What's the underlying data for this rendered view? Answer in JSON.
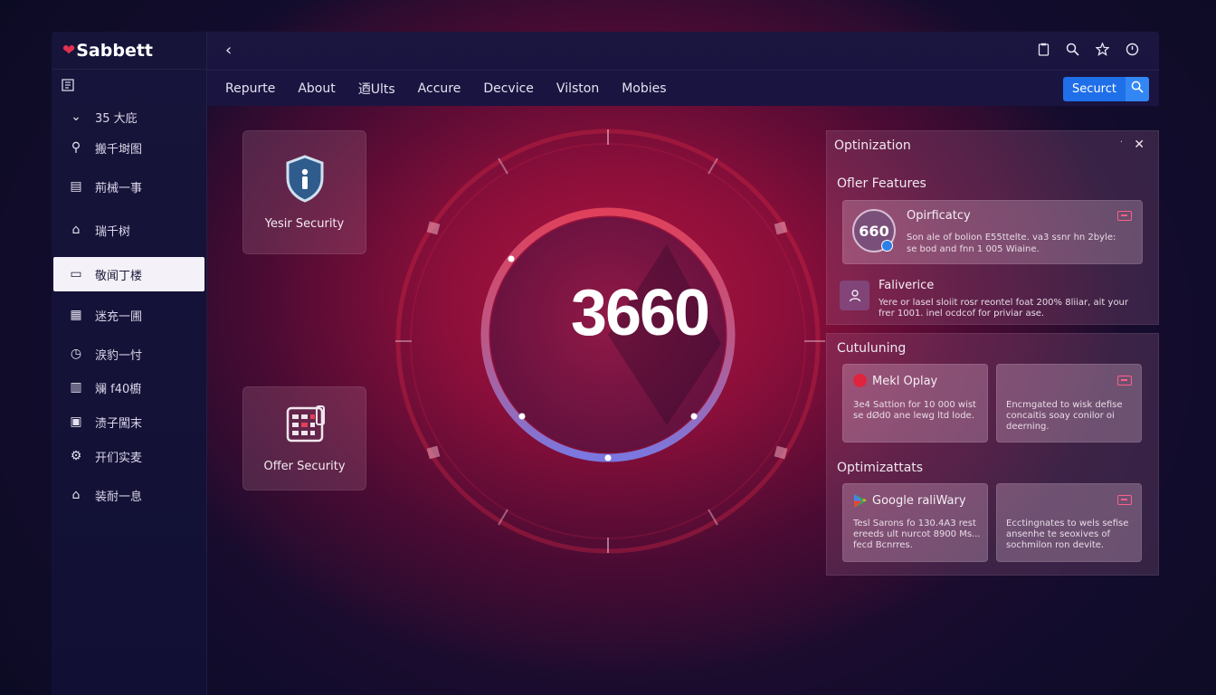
{
  "app": {
    "brand": "Sabbett"
  },
  "sidebar": {
    "items": [
      {
        "label": "35 大庇",
        "icon": "chevron-down-icon"
      },
      {
        "label": "搬千埘图",
        "icon": "search-icon"
      },
      {
        "label": "荊械一事",
        "icon": "list-icon"
      },
      {
        "label": "瑞千树",
        "icon": "home-icon"
      },
      {
        "label": "敬闻丁楼",
        "icon": "document-icon",
        "active": true
      },
      {
        "label": "迷充一圃",
        "icon": "grid-icon"
      },
      {
        "label": "涙豹一忖",
        "icon": "history-icon"
      },
      {
        "label": "斓 f40櫥",
        "icon": "calendar-icon"
      },
      {
        "label": "渍子闖末",
        "icon": "card-icon"
      },
      {
        "label": "开们实麦",
        "icon": "gear-icon"
      },
      {
        "label": "装耐一息",
        "icon": "home-icon"
      }
    ]
  },
  "header": {
    "tabs": [
      "Repurte",
      "About",
      "迺Ults",
      "Accure",
      "Decvice",
      "Vilston",
      "Mobies"
    ],
    "search_label": "Securct"
  },
  "cards": {
    "security_label": "Yesir Security",
    "offer_label": "Offer Security"
  },
  "score": "3660",
  "panel": {
    "title": "Optinization",
    "features_title": "Ofler Features",
    "feature1": {
      "badge": "660",
      "title": "Opirficatcy",
      "desc_line1": "Son ale of bolion E55ttelte. va3 ssnr hn 2byle:",
      "desc_line2": "se bod and fnn 1 005 Wiaine."
    },
    "feature2": {
      "title": "Faliverice",
      "desc_line1": "Yere or lasel sloiit rosr reontel foat 200% 8liiar, ait your",
      "desc_line2": "frer 1001. inel ocdcof for priviar ase."
    },
    "section2_title": "Cutuluning",
    "card1": {
      "title": "Mekl Oplay",
      "desc_line1": "3e4 Sattion for 10 000 wist",
      "desc_line2": "se dØd0 ane lewg ltd lode."
    },
    "card2": {
      "desc_line1": "Encmgated to wisk defise",
      "desc_line2": "concaitis soay conilor oi",
      "desc_line3": "deerning."
    },
    "section3_title": "Optimizattats",
    "card3": {
      "title": "Google raliWary",
      "desc_line1": "Tesl Sarons fo 130.4A3 rest",
      "desc_line2": "ereeds ult nurcot 8900 Ms...",
      "desc_line3": "fecd Bcnrres."
    },
    "card4": {
      "desc_line1": "Ecctingnates to wels sefise",
      "desc_line2": "ansenhe te seoxives of",
      "desc_line3": "sochmilon ron devite."
    }
  },
  "colors": {
    "accent": "#1f6fe8",
    "danger_icon": "#ff5f86",
    "ring_start": "#e0405a",
    "ring_end": "#7a6fd8"
  }
}
